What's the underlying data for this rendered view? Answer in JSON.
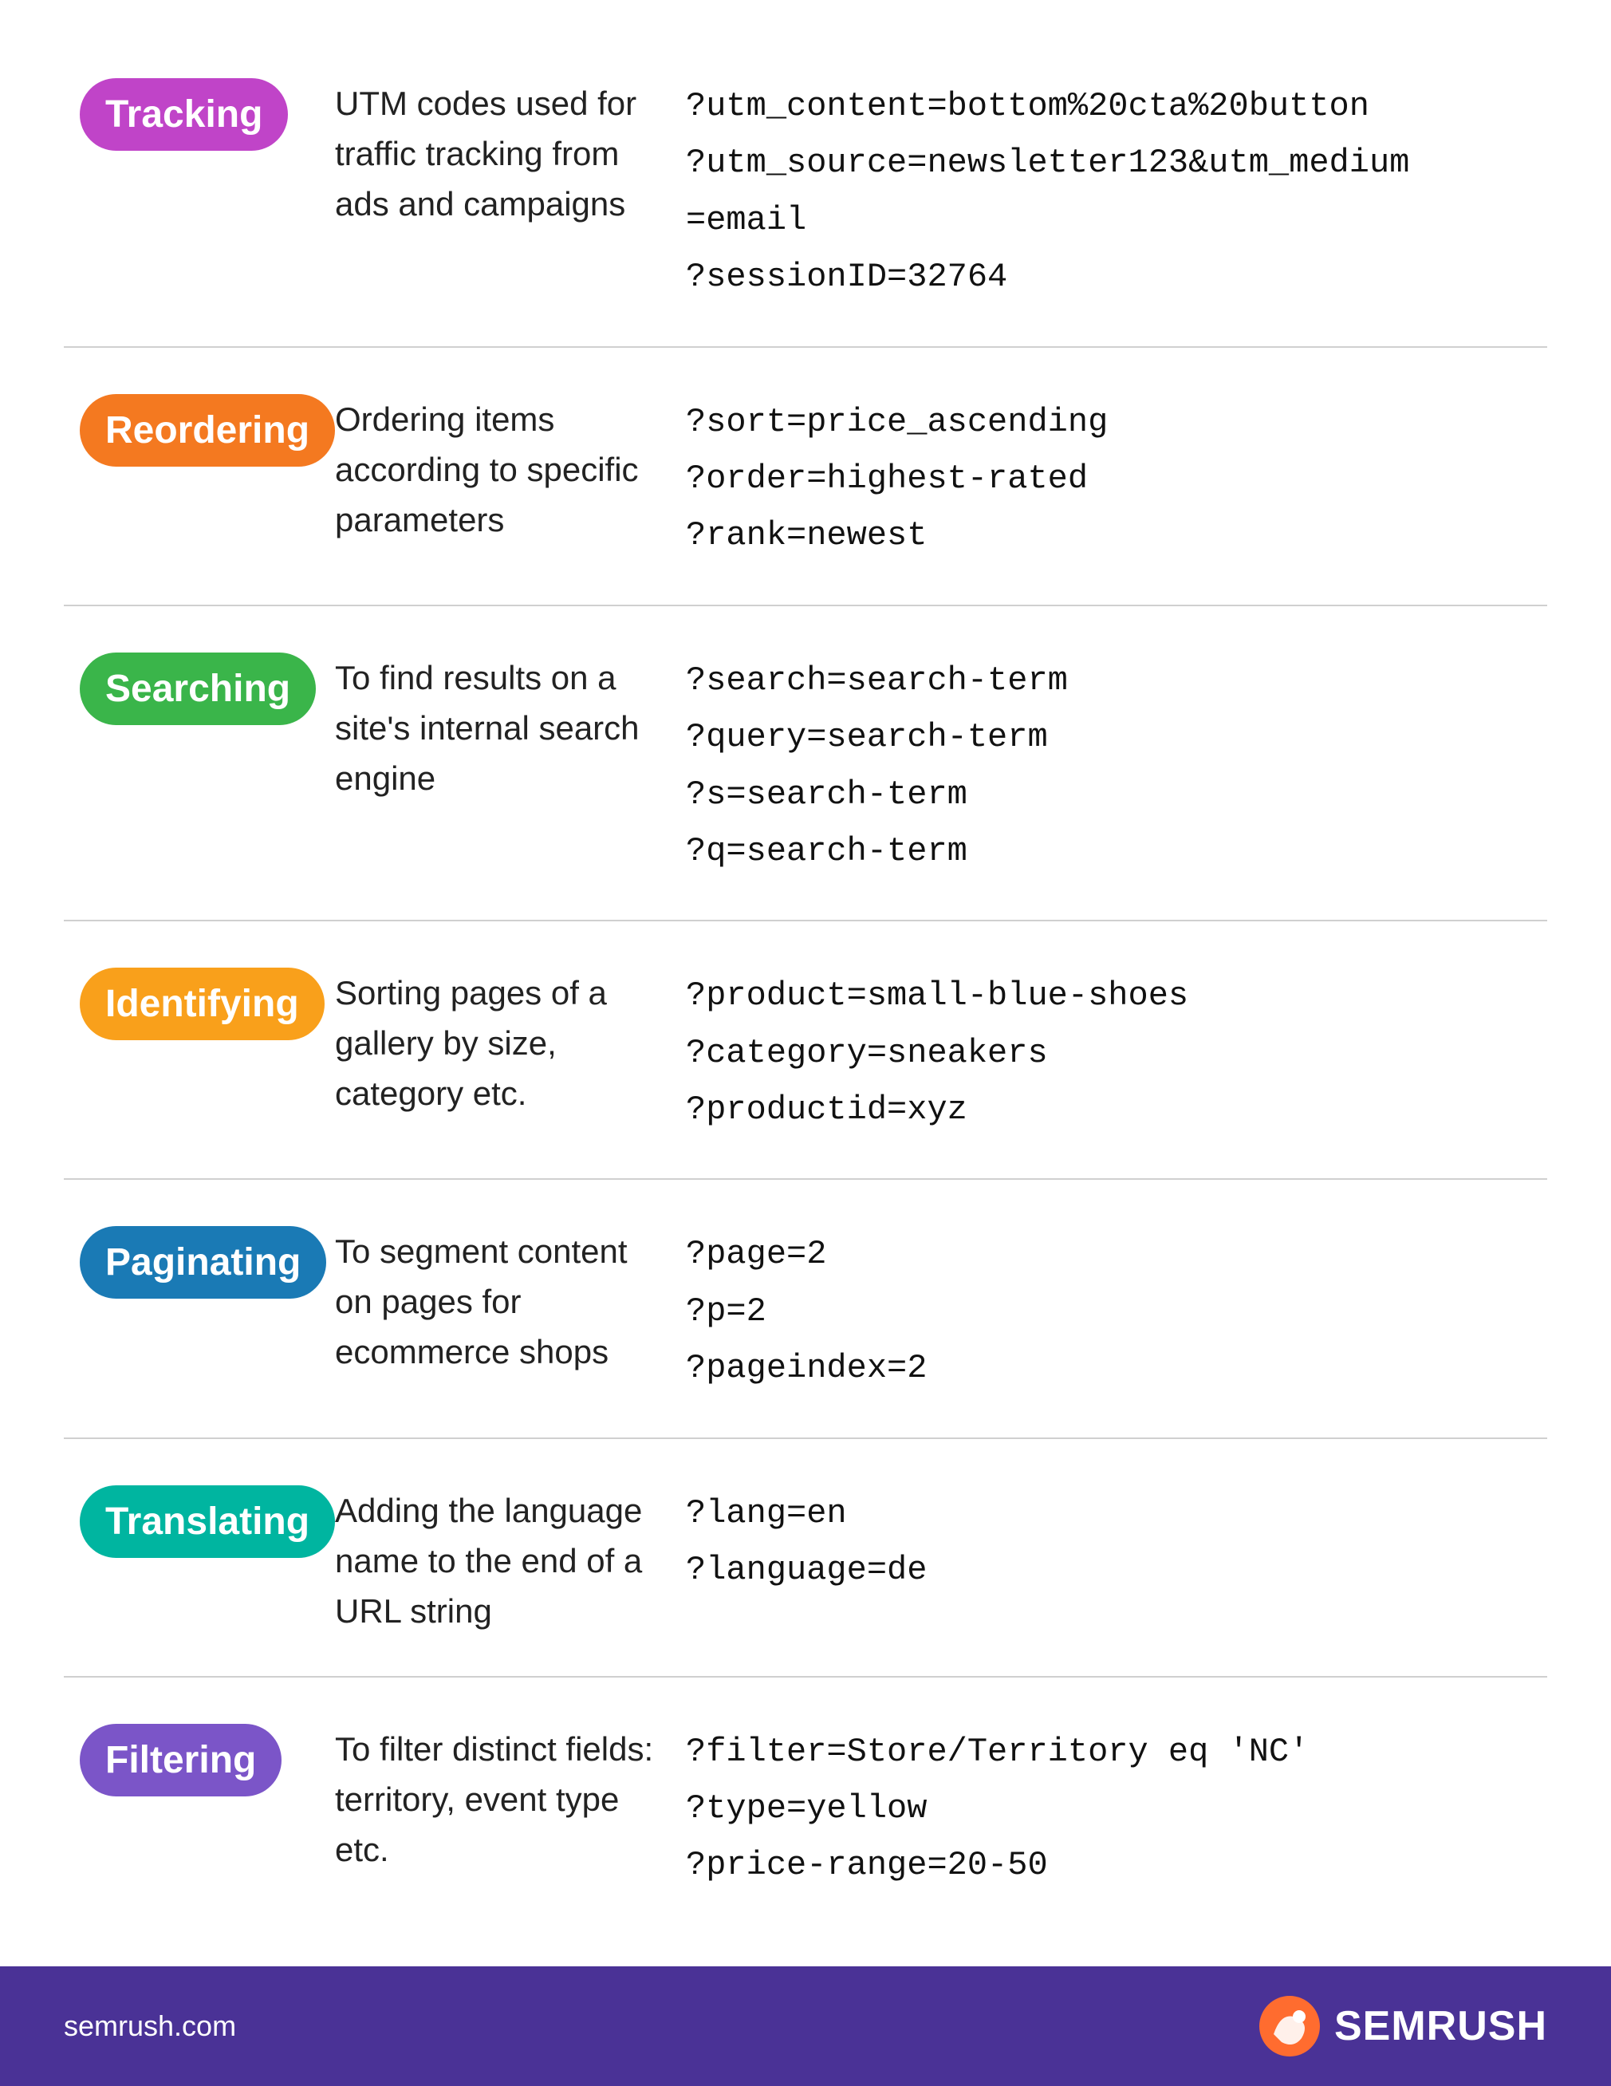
{
  "rows": [
    {
      "id": "tracking",
      "badge_class": "badge-tracking",
      "label": "Tracking",
      "description": "UTM codes used for traffic tracking from ads and campaigns",
      "examples": "?utm_content=bottom%20cta%20button\n?utm_source=newsletter123&utm_medium\n=email\n?sessionID=32764"
    },
    {
      "id": "reordering",
      "badge_class": "badge-reordering",
      "label": "Reordering",
      "description": "Ordering items according to specific parameters",
      "examples": "?sort=price_ascending\n?order=highest-rated\n?rank=newest"
    },
    {
      "id": "searching",
      "badge_class": "badge-searching",
      "label": "Searching",
      "description": "To find results on a site's internal search engine",
      "examples": "?search=search-term\n?query=search-term\n?s=search-term\n?q=search-term"
    },
    {
      "id": "identifying",
      "badge_class": "badge-identifying",
      "label": "Identifying",
      "description": "Sorting pages of a gallery by size, category etc.",
      "examples": "?product=small-blue-shoes\n?category=sneakers\n?productid=xyz"
    },
    {
      "id": "paginating",
      "badge_class": "badge-paginating",
      "label": "Paginating",
      "description": "To segment content on pages for ecommerce shops",
      "examples": "?page=2\n?p=2\n?pageindex=2"
    },
    {
      "id": "translating",
      "badge_class": "badge-translating",
      "label": "Translating",
      "description": "Adding the language name to the end of a URL string",
      "examples": "?lang=en\n?language=de"
    },
    {
      "id": "filtering",
      "badge_class": "badge-filtering",
      "label": "Filtering",
      "description": "To filter distinct fields: territory, event type etc.",
      "examples": "?filter=Store/Territory eq 'NC'\n?type=yellow\n?price-range=20-50"
    }
  ],
  "footer": {
    "url": "semrush.com",
    "logo_text": "SEMRUSH"
  }
}
